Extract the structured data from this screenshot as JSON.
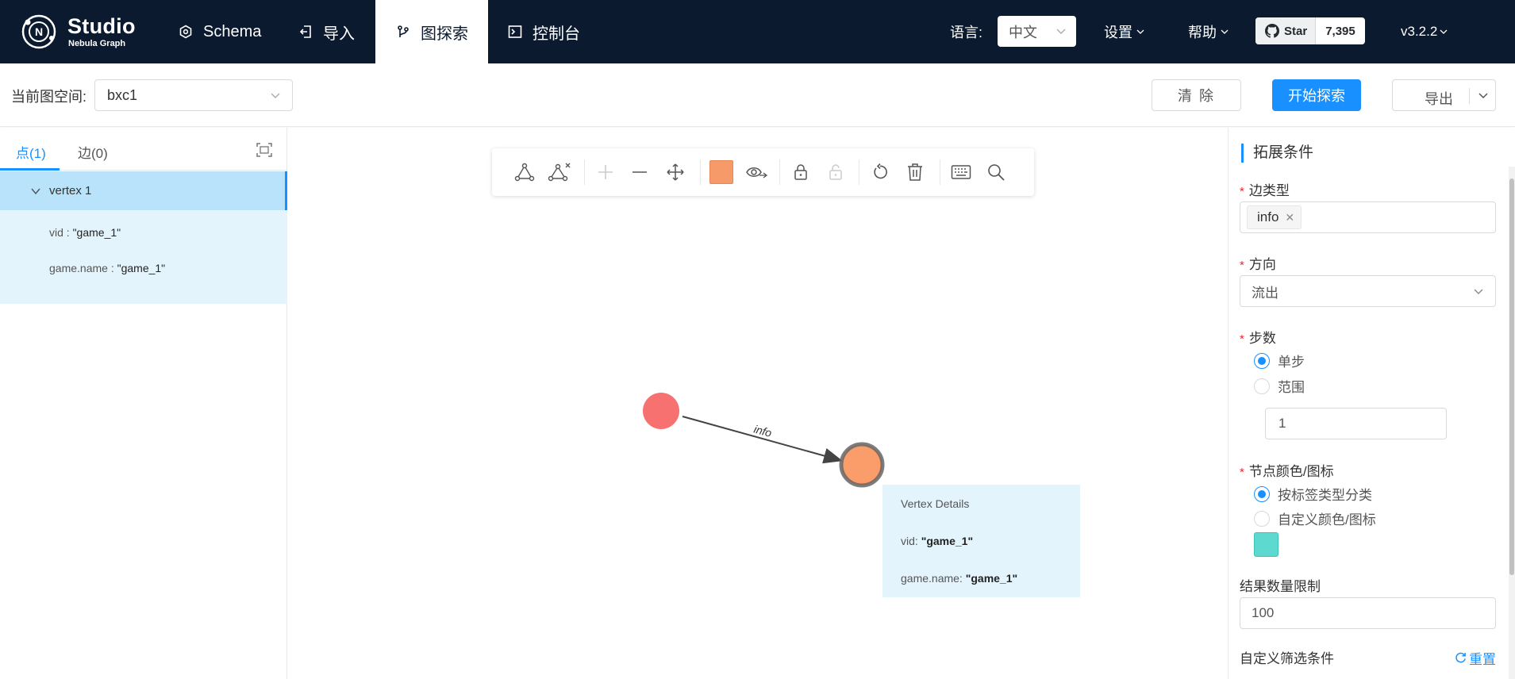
{
  "nav": {
    "logo_title": "Studio",
    "logo_subtitle": "Nebula Graph",
    "items": [
      {
        "label": "Schema",
        "icon": "schema-icon"
      },
      {
        "label": "导入",
        "icon": "import-icon"
      },
      {
        "label": "图探索",
        "icon": "explore-icon"
      },
      {
        "label": "控制台",
        "icon": "console-icon"
      }
    ],
    "language_label": "语言:",
    "language_value": "中文",
    "settings_label": "设置",
    "help_label": "帮助",
    "github_star_label": "Star",
    "github_star_count": "7,395",
    "version": "v3.2.2"
  },
  "subheader": {
    "space_label": "当前图空间:",
    "space_value": "bxc1",
    "clear_label": "清 除",
    "explore_label": "开始探索",
    "export_label": "导出"
  },
  "left_panel": {
    "tab_vertices": "点(1)",
    "tab_edges": "边(0)",
    "vertex_title": "vertex 1",
    "props": [
      {
        "key": "vid",
        "value": "\"game_1\""
      },
      {
        "key": "game.name",
        "value": "\"game_1\""
      }
    ]
  },
  "graph": {
    "edge_label": "info",
    "source_color": "#f87171",
    "target_color": "#fb9d6b",
    "tooltip": {
      "title": "Vertex Details",
      "rows": [
        {
          "key": "vid:",
          "value": "\"game_1\""
        },
        {
          "key": "game.name:",
          "value": "\"game_1\""
        }
      ]
    }
  },
  "right_panel": {
    "title": "拓展条件",
    "edge_type_label": "边类型",
    "edge_type_tag": "info",
    "direction_label": "方向",
    "direction_value": "流出",
    "steps_label": "步数",
    "steps_single": "单步",
    "steps_range": "范围",
    "steps_value": "1",
    "node_color_label": "节点颜色/图标",
    "node_color_by_tag": "按标签类型分类",
    "node_color_custom": "自定义颜色/图标",
    "result_limit_label": "结果数量限制",
    "result_limit_value": "100",
    "custom_filter_label": "自定义筛选条件",
    "reset_label": "重置"
  },
  "colors": {
    "nav_bg": "#0b1a2e",
    "accent": "#1890ff",
    "swatch": "#5dd9cf"
  }
}
